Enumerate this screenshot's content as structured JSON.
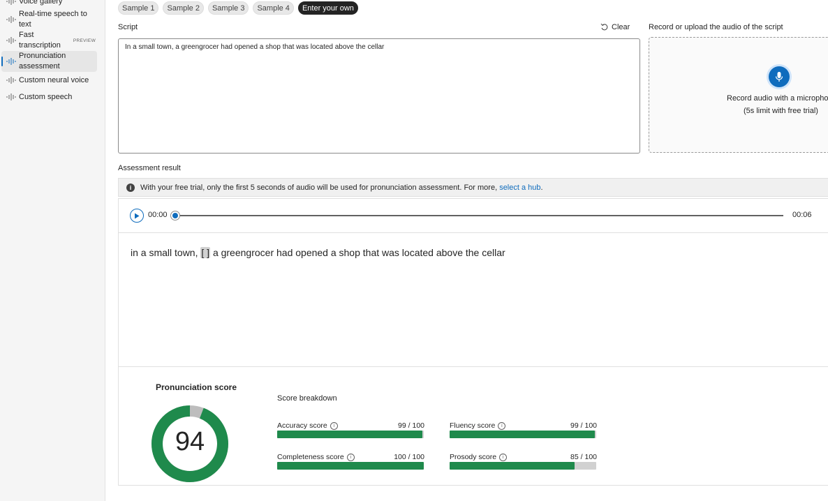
{
  "sidebar": {
    "items": [
      {
        "label": "Voice gallery"
      },
      {
        "label": "Real-time speech to text"
      },
      {
        "label": "Fast transcription",
        "badge": "PREVIEW"
      },
      {
        "label": "Pronunciation assessment"
      },
      {
        "label": "Custom neural voice"
      },
      {
        "label": "Custom speech"
      }
    ]
  },
  "samples": [
    "Sample 1",
    "Sample 2",
    "Sample 3",
    "Sample 4",
    "Enter your own"
  ],
  "script": {
    "label": "Script",
    "clear": "Clear",
    "text": "In a small town, a greengrocer had opened a shop that was located above the cellar"
  },
  "record": {
    "label": "Record or upload the audio of the script",
    "line1": "Record audio with a microphone",
    "line2": "(5s limit with free trial)"
  },
  "assessment": {
    "label": "Assessment result",
    "info_text": "With your free trial, only the first 5 seconds of audio will be used for pronunciation assessment. For more,",
    "info_link": "select a hub",
    "info_end": ".",
    "current_time": "00:00",
    "total_time": "00:06",
    "transcript_before": "in a small town,",
    "pause_marker": "[ ]",
    "transcript_after": "a greengrocer had opened a shop that was located above the cellar"
  },
  "scores": {
    "title": "Pronunciation score",
    "overall": 94,
    "breakdown_label": "Score breakdown",
    "metrics": [
      {
        "label": "Accuracy score",
        "value": 99,
        "display": "99 / 100"
      },
      {
        "label": "Fluency score",
        "value": 99,
        "display": "99 / 100"
      },
      {
        "label": "Completeness score",
        "value": 100,
        "display": "100 / 100"
      },
      {
        "label": "Prosody score",
        "value": 85,
        "display": "85 / 100"
      }
    ]
  },
  "colors": {
    "accent": "#0f6cbd",
    "good": "#1f8a4c",
    "track": "#d1d1d1"
  }
}
